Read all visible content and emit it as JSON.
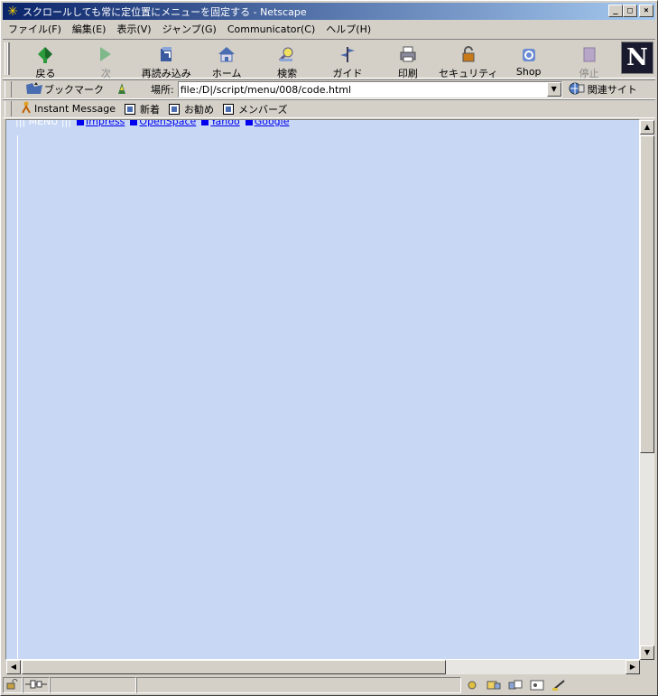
{
  "window": {
    "title": "スクロールしても常に定位置にメニューを固定する - Netscape",
    "minimize_glyph": "_",
    "maximize_glyph": "□",
    "close_glyph": "×"
  },
  "menubar": {
    "items": [
      {
        "label": "ファイル(F)"
      },
      {
        "label": "編集(E)"
      },
      {
        "label": "表示(V)"
      },
      {
        "label": "ジャンプ(G)"
      },
      {
        "label": "Communicator(C)"
      },
      {
        "label": "ヘルプ(H)"
      }
    ]
  },
  "navbar": {
    "buttons": [
      {
        "label": "戻る",
        "icon": "back-arrow-icon"
      },
      {
        "label": "次",
        "icon": "forward-arrow-icon"
      },
      {
        "label": "再読み込み",
        "icon": "reload-icon"
      },
      {
        "label": "ホーム",
        "icon": "home-icon"
      },
      {
        "label": "検索",
        "icon": "search-icon"
      },
      {
        "label": "ガイド",
        "icon": "guide-icon"
      },
      {
        "label": "印刷",
        "icon": "print-icon"
      },
      {
        "label": "セキュリティ",
        "icon": "security-lock-icon"
      },
      {
        "label": "Shop",
        "icon": "shop-icon"
      },
      {
        "label": "停止",
        "icon": "stop-icon"
      }
    ],
    "logo_letter": "N"
  },
  "locbar": {
    "bookmark_label": "ブックマーク",
    "location_label": "場所:",
    "url": "file:/D|/script/menu/008/code.html",
    "related_label": "関連サイト"
  },
  "personalbar": {
    "items": [
      {
        "label": "Instant Message"
      },
      {
        "label": "新着"
      },
      {
        "label": "お勧め"
      },
      {
        "label": "メンバーズ"
      }
    ]
  },
  "page": {
    "menu_head": "||| MENU |||",
    "links": [
      {
        "label": "Impress"
      },
      {
        "label": "OpenSpace"
      },
      {
        "label": "Yahoo"
      },
      {
        "label": "Google"
      }
    ]
  },
  "scroll": {
    "vertical_position": 0.0,
    "horizontal_position": 0.0
  },
  "colors": {
    "content_bg": "#c8d8f4",
    "link": "#0000ee",
    "title_gradient_start": "#0a246a",
    "title_gradient_end": "#a6caf0"
  }
}
